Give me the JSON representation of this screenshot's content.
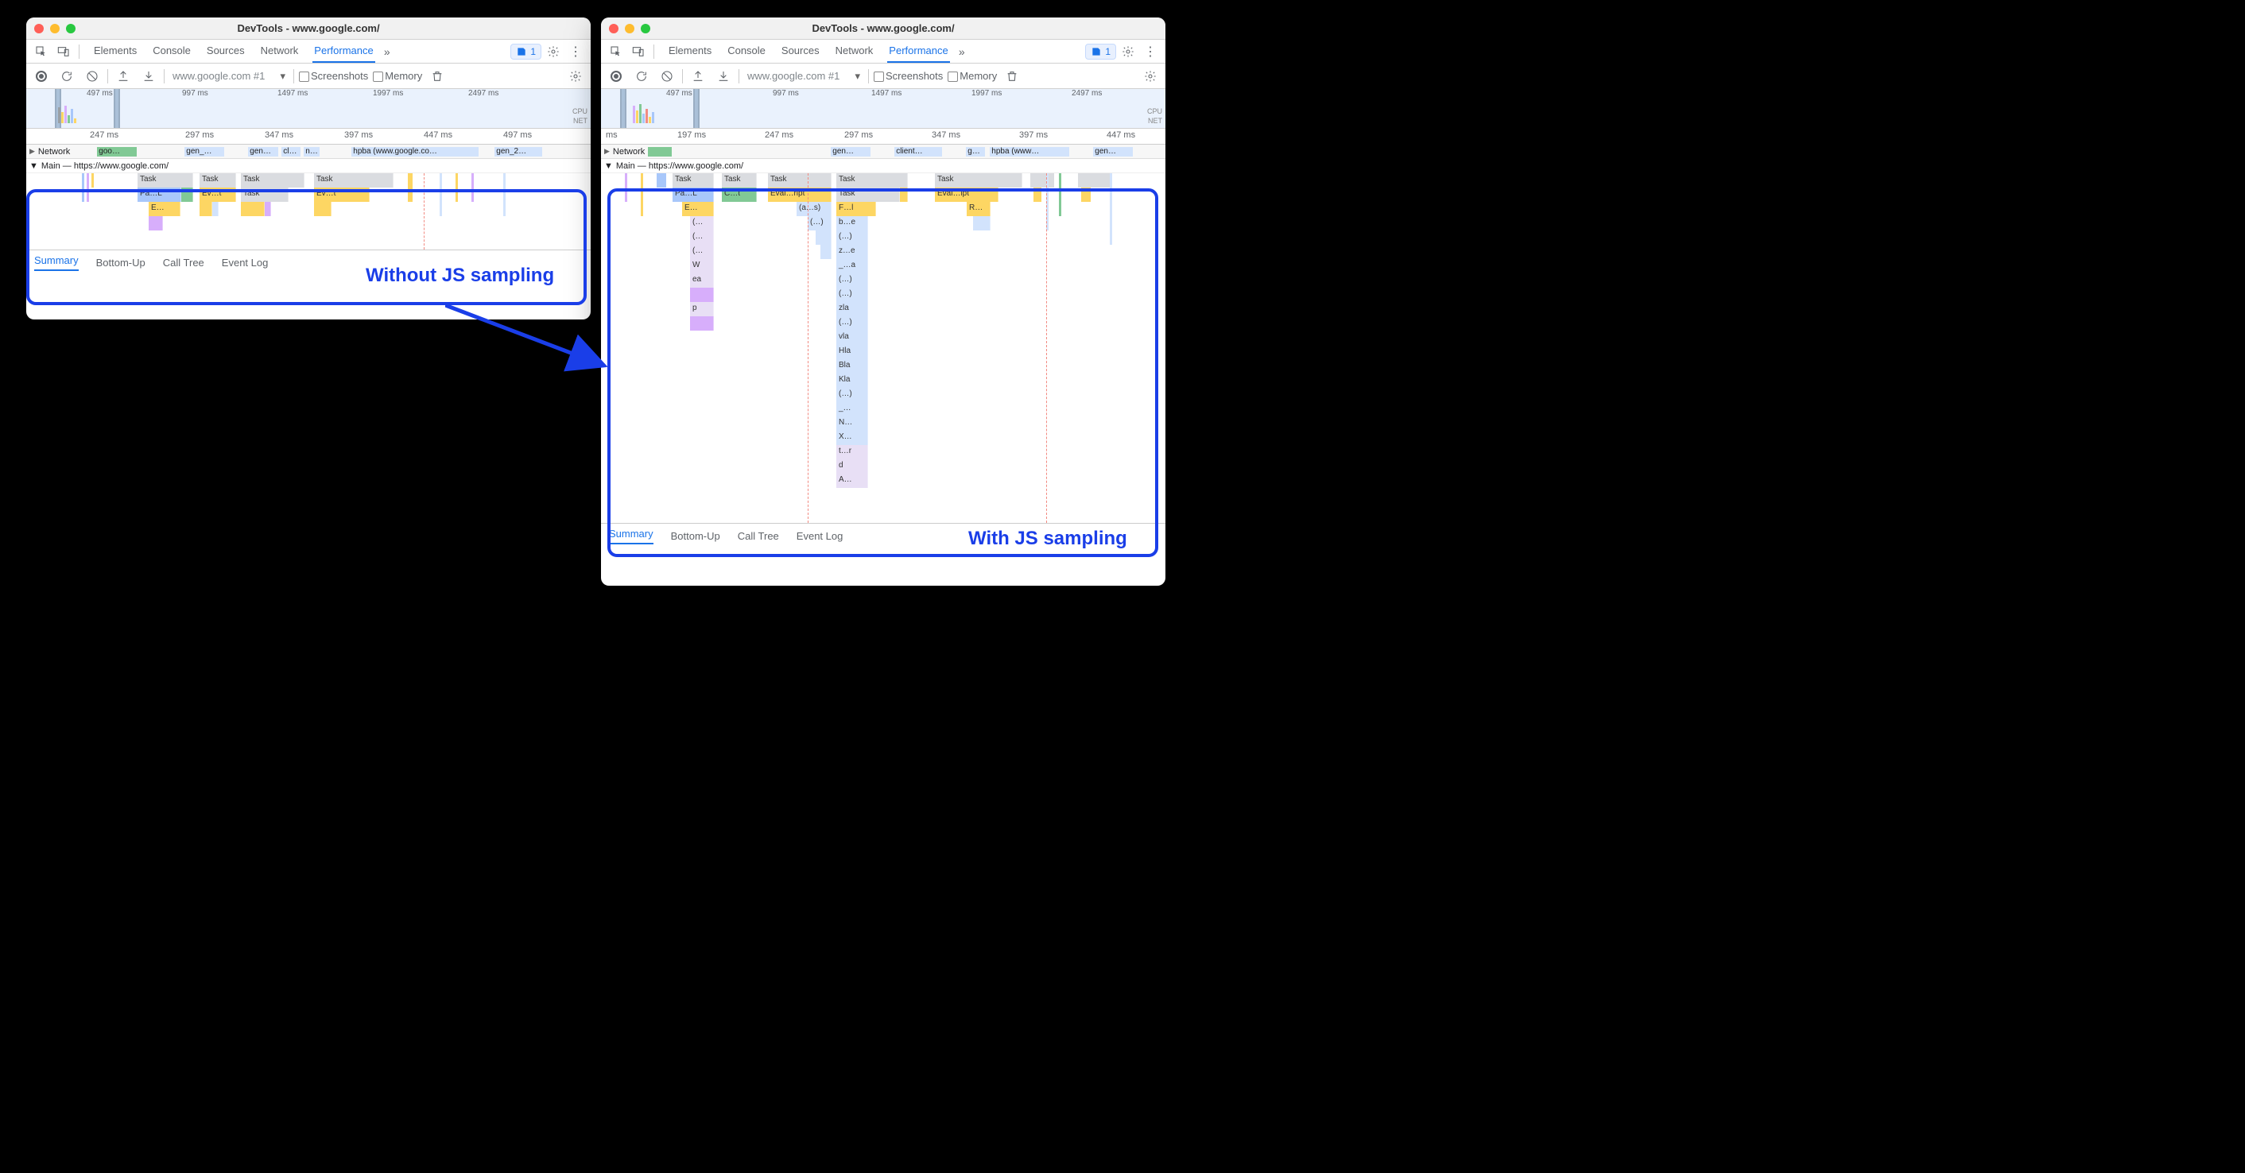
{
  "window_title": "DevTools - www.google.com/",
  "main_tabs": [
    "Elements",
    "Console",
    "Sources",
    "Network",
    "Performance"
  ],
  "active_main_tab": "Performance",
  "chip_count": "1",
  "recording_select": "www.google.com #1",
  "checkboxes": {
    "screenshots": "Screenshots",
    "memory": "Memory"
  },
  "overview": {
    "left_ticks": [
      "497 ms",
      "997 ms",
      "1497 ms",
      "1997 ms",
      "2497 ms"
    ],
    "right_labels": [
      "CPU",
      "NET"
    ]
  },
  "ruler_left": [
    "247 ms",
    "297 ms",
    "347 ms",
    "397 ms",
    "447 ms",
    "497 ms"
  ],
  "ruler_right": [
    "ms",
    "197 ms",
    "247 ms",
    "297 ms",
    "347 ms",
    "397 ms",
    "447 ms"
  ],
  "network_label": "Network",
  "net_left": [
    "goo…",
    "gen_…",
    "gen…",
    "cl…",
    "n…",
    "hpba (www.google.co…",
    "gen_2…"
  ],
  "net_right": [
    "gen…",
    "client…",
    "g…",
    "hpba (www…",
    "gen…"
  ],
  "main_label": "Main — https://www.google.com/",
  "left_flame": {
    "row0": [
      "Task",
      "Task",
      "Task",
      "Task"
    ],
    "row1": [
      "Pa…L",
      "Ev…t",
      "Task",
      "Ev…t"
    ],
    "row2": [
      "E…"
    ]
  },
  "right_flame": {
    "col0": [
      "Task",
      "Pa…L",
      "E…",
      "(…",
      "(…",
      "(…",
      "W",
      "ea",
      "",
      "p"
    ],
    "col1": [
      "Task",
      "C…t"
    ],
    "col2": [
      "Task",
      "Eval…ript",
      "(a…s)",
      "(…)"
    ],
    "col3": [
      "Task",
      "Task",
      "F…l",
      "b…e",
      "(…)",
      "z…e",
      "_…a",
      "(…)",
      "(…)",
      "zla",
      "(…)",
      "vla",
      "Hla",
      "Bla",
      "Kla",
      "(…)",
      "_…",
      "N…",
      "X…",
      "t…r",
      "d",
      "A…"
    ],
    "col4": [
      "Task",
      "Eval…ipt",
      "R…"
    ]
  },
  "annotations": {
    "left": "Without JS sampling",
    "right": "With JS sampling"
  },
  "bottom_tabs": [
    "Summary",
    "Bottom-Up",
    "Call Tree",
    "Event Log"
  ],
  "active_bottom_tab": "Summary"
}
